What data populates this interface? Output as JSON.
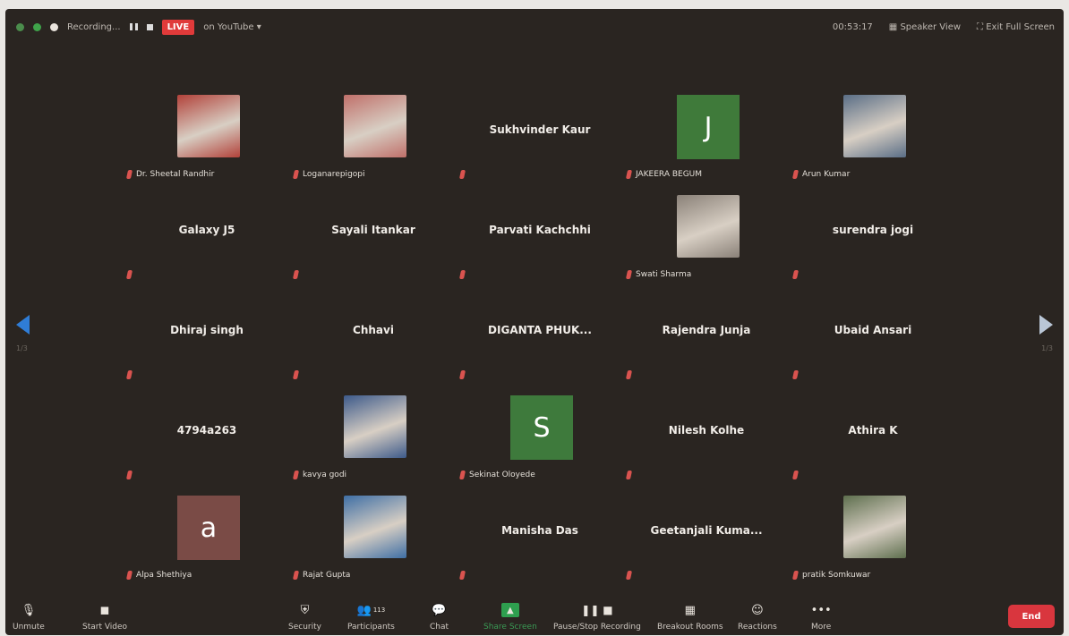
{
  "topbar": {
    "recording_label": "Recording...",
    "live_label": "LIVE",
    "stream_target": "on YouTube ▾",
    "timer": "00:53:17",
    "speaker_view_label": "Speaker View",
    "exit_fullscreen_label": "Exit Full Screen"
  },
  "pager": {
    "left": "1/3",
    "right": "1/3"
  },
  "participants": [
    {
      "display": "photo",
      "label": "Dr. Sheetal Randhir",
      "photo_color": "#b2423a"
    },
    {
      "display": "photo",
      "label": "Loganarepigopi",
      "photo_color": "#c0706a"
    },
    {
      "display": "name",
      "name": "Sukhvinder Kaur"
    },
    {
      "display": "avatar",
      "letter": "J",
      "avatar_color": "#3f7a3a",
      "label": "JAKEERA BEGUM"
    },
    {
      "display": "photo",
      "label": "Arun Kumar",
      "photo_color": "#5a6e86"
    },
    {
      "display": "name",
      "name": "Galaxy J5"
    },
    {
      "display": "name",
      "name": "Sayali Itankar"
    },
    {
      "display": "name",
      "name": "Parvati Kachchhi"
    },
    {
      "display": "photo",
      "label": "Swati Sharma",
      "photo_color": "#8a8178"
    },
    {
      "display": "name",
      "name": "surendra jogi"
    },
    {
      "display": "name",
      "name": "Dhiraj singh"
    },
    {
      "display": "name",
      "name": "Chhavi"
    },
    {
      "display": "name",
      "name": "DIGANTA PHUK..."
    },
    {
      "display": "name",
      "name": "Rajendra Junja"
    },
    {
      "display": "name",
      "name": "Ubaid Ansari"
    },
    {
      "display": "name",
      "name": "4794a263"
    },
    {
      "display": "photo",
      "label": "kavya godi",
      "photo_color": "#3d5a8a"
    },
    {
      "display": "avatar",
      "letter": "S",
      "avatar_color": "#3e7a3c",
      "label": "Sekinat Oloyede"
    },
    {
      "display": "name",
      "name": "Nilesh Kolhe"
    },
    {
      "display": "name",
      "name": "Athira K"
    },
    {
      "display": "avatar",
      "letter": "a",
      "avatar_color": "#7a4b46",
      "label": "Alpa Shethiya"
    },
    {
      "display": "photo",
      "label": "Rajat Gupta",
      "photo_color": "#3f6fa5"
    },
    {
      "display": "name",
      "name": "Manisha Das"
    },
    {
      "display": "name",
      "name": "Geetanjali Kuma..."
    },
    {
      "display": "photo",
      "label": "pratik Somkuwar",
      "photo_color": "#5e6f4e"
    }
  ],
  "toolbar": {
    "unmute": "Unmute",
    "start_video": "Start Video",
    "security": "Security",
    "participants": "Participants",
    "participants_count": "113",
    "chat": "Chat",
    "share_screen": "Share Screen",
    "pause_stop_recording": "Pause/Stop Recording",
    "breakout_rooms": "Breakout Rooms",
    "reactions": "Reactions",
    "more": "More",
    "end": "End"
  },
  "colors": {
    "live_red": "#e03a3a",
    "end_red": "#d9363e",
    "share_green": "#2e9f4f",
    "muted_mic": "#d9534f"
  }
}
